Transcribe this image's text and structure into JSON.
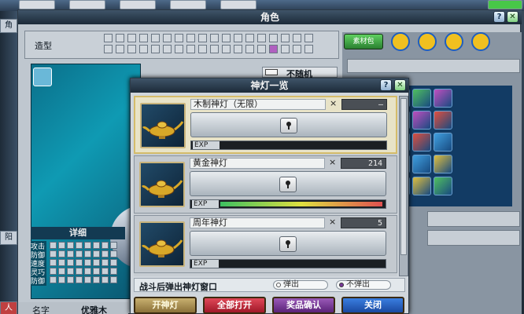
{
  "sidebar": {
    "tab1": "角",
    "tab2": "阳",
    "tab3": "人"
  },
  "role_window": {
    "title": "角色",
    "help_label": "?",
    "close_label": "✕",
    "appearance_label": "造型",
    "random_toggle_label": "不随机",
    "detail_header": "详细",
    "stats": [
      "攻击",
      "防御",
      "速度",
      "灵巧",
      "防御"
    ],
    "name_label": "名字",
    "name_value": "优雅木",
    "inventory_label": "素材包"
  },
  "lamp_dialog": {
    "title": "神灯一览",
    "help_label": "?",
    "close_label": "✕",
    "exp_label": "EXP",
    "x_label": "×",
    "lamps": [
      {
        "name": "木制神灯（无限）",
        "count": "—",
        "exp_percent": 0,
        "selected": true
      },
      {
        "name": "黄金神灯",
        "count": "214",
        "exp_percent": 100,
        "selected": false
      },
      {
        "name": "周年神灯",
        "count": "5",
        "exp_percent": 0,
        "selected": false
      }
    ],
    "battle_popup_label": "战斗后弹出神灯窗口",
    "popup_option": "弹出",
    "no_popup_option": "不弹出",
    "buttons": {
      "open_lamp": "开神灯",
      "open_all": "全部打开",
      "confirm_prize": "奖品确认",
      "close": "关闭"
    }
  },
  "colors": {
    "exp_gradient_start": "#3cc060",
    "exp_gradient_end": "#e05050",
    "button_red": "#c0283a",
    "button_purple": "#7a3a9a",
    "button_blue": "#1e5ec0",
    "button_gold": "#b09040"
  }
}
